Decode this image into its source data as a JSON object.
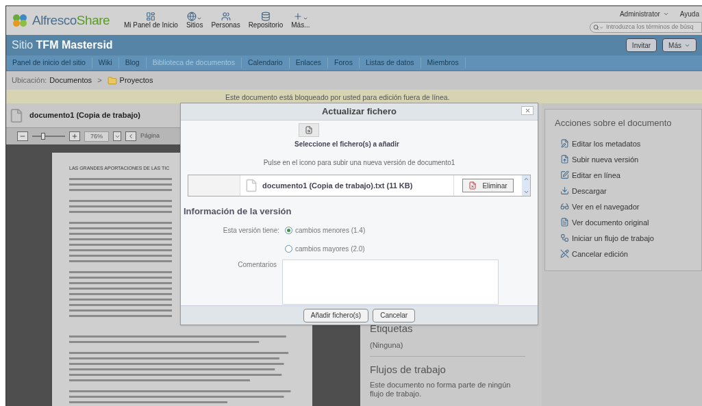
{
  "header": {
    "logo": {
      "part_a": "Alfresco",
      "part_b": "Share"
    },
    "nav": [
      {
        "label": "Mi Panel de Inicio",
        "kind": "dashboard",
        "dropdown": false
      },
      {
        "label": "Sitios",
        "kind": "sites",
        "dropdown": true
      },
      {
        "label": "Personas",
        "kind": "people",
        "dropdown": false
      },
      {
        "label": "Repositorio",
        "kind": "repository",
        "dropdown": false
      },
      {
        "label": "Más...",
        "kind": "more",
        "dropdown": true
      }
    ],
    "user_menu": "Administrator",
    "help": "Ayuda",
    "search": {
      "placeholder": "Introduzca los términos de búsq"
    }
  },
  "site": {
    "prefix": "Sitio",
    "name": "TFM Mastersid",
    "buttons": [
      {
        "label": "Invitar",
        "dropdown": false
      },
      {
        "label": "Más",
        "dropdown": true
      }
    ]
  },
  "site_nav": [
    {
      "label": "Panel de inicio del sitio",
      "selected": false
    },
    {
      "label": "Wiki",
      "selected": false
    },
    {
      "label": "Blog",
      "selected": false
    },
    {
      "label": "Biblioteca de documentos",
      "selected": true
    },
    {
      "label": "Calendario",
      "selected": false
    },
    {
      "label": "Enlaces",
      "selected": false
    },
    {
      "label": "Foros",
      "selected": false
    },
    {
      "label": "Listas de datos",
      "selected": false
    },
    {
      "label": "Miembros",
      "selected": false
    }
  ],
  "breadcrumb": {
    "label": "Ubicación:",
    "separator": ">",
    "items": [
      {
        "label": "Documentos",
        "kind": "link"
      },
      {
        "label": "Proyectos",
        "kind": "folder"
      }
    ]
  },
  "banner": "Este documento está bloqueado por usted para edición fuera de línea.",
  "document": {
    "title": "documento1 (Copia de trabajo)",
    "zoom_slider": {
      "level": 0.3
    },
    "zoom_level": "76%",
    "page_label": "Página",
    "page_heading": "LAS GRANDES APORTACIONES DE LAS TIC"
  },
  "details": {
    "tags_heading": "Etiquetas",
    "tags_value": "(Ninguna)",
    "workflows_heading": "Flujos de trabajo",
    "workflows_text": "Este documento no forma parte de ningún flujo de trabajo."
  },
  "actions": {
    "title": "Acciones sobre el documento",
    "items": [
      {
        "label": "Editar los metadatos",
        "kind": "edit-metadata"
      },
      {
        "label": "Subir nueva versión",
        "kind": "upload"
      },
      {
        "label": "Editar en línea",
        "kind": "edit-online"
      },
      {
        "label": "Descargar",
        "kind": "download"
      },
      {
        "label": "Ver en el navegador",
        "kind": "view-browser"
      },
      {
        "label": "Ver documento original",
        "kind": "view-original"
      },
      {
        "label": "Iniciar un flujo de trabajo",
        "kind": "workflow"
      },
      {
        "label": "Cancelar edición",
        "kind": "cancel-edit"
      }
    ]
  },
  "dialog": {
    "title": "Actualizar fichero",
    "select_label": "Seleccione el fichero(s) a añadir",
    "hint": "Pulse en el icono para subir una nueva versión de documento1",
    "file": {
      "name": "documento1 (Copia de trabajo).txt (11 KB)",
      "remove": "Eliminar"
    },
    "section": "Información de la versión",
    "version_label": "Esta versión tiene:",
    "options": [
      {
        "label": "cambios menores (1.4)",
        "selected": true
      },
      {
        "label": "cambios mayores (2.0)",
        "selected": false
      }
    ],
    "comments_label": "Comentarios",
    "buttons": [
      "Añadir fichero(s)",
      "Cancelar"
    ]
  }
}
